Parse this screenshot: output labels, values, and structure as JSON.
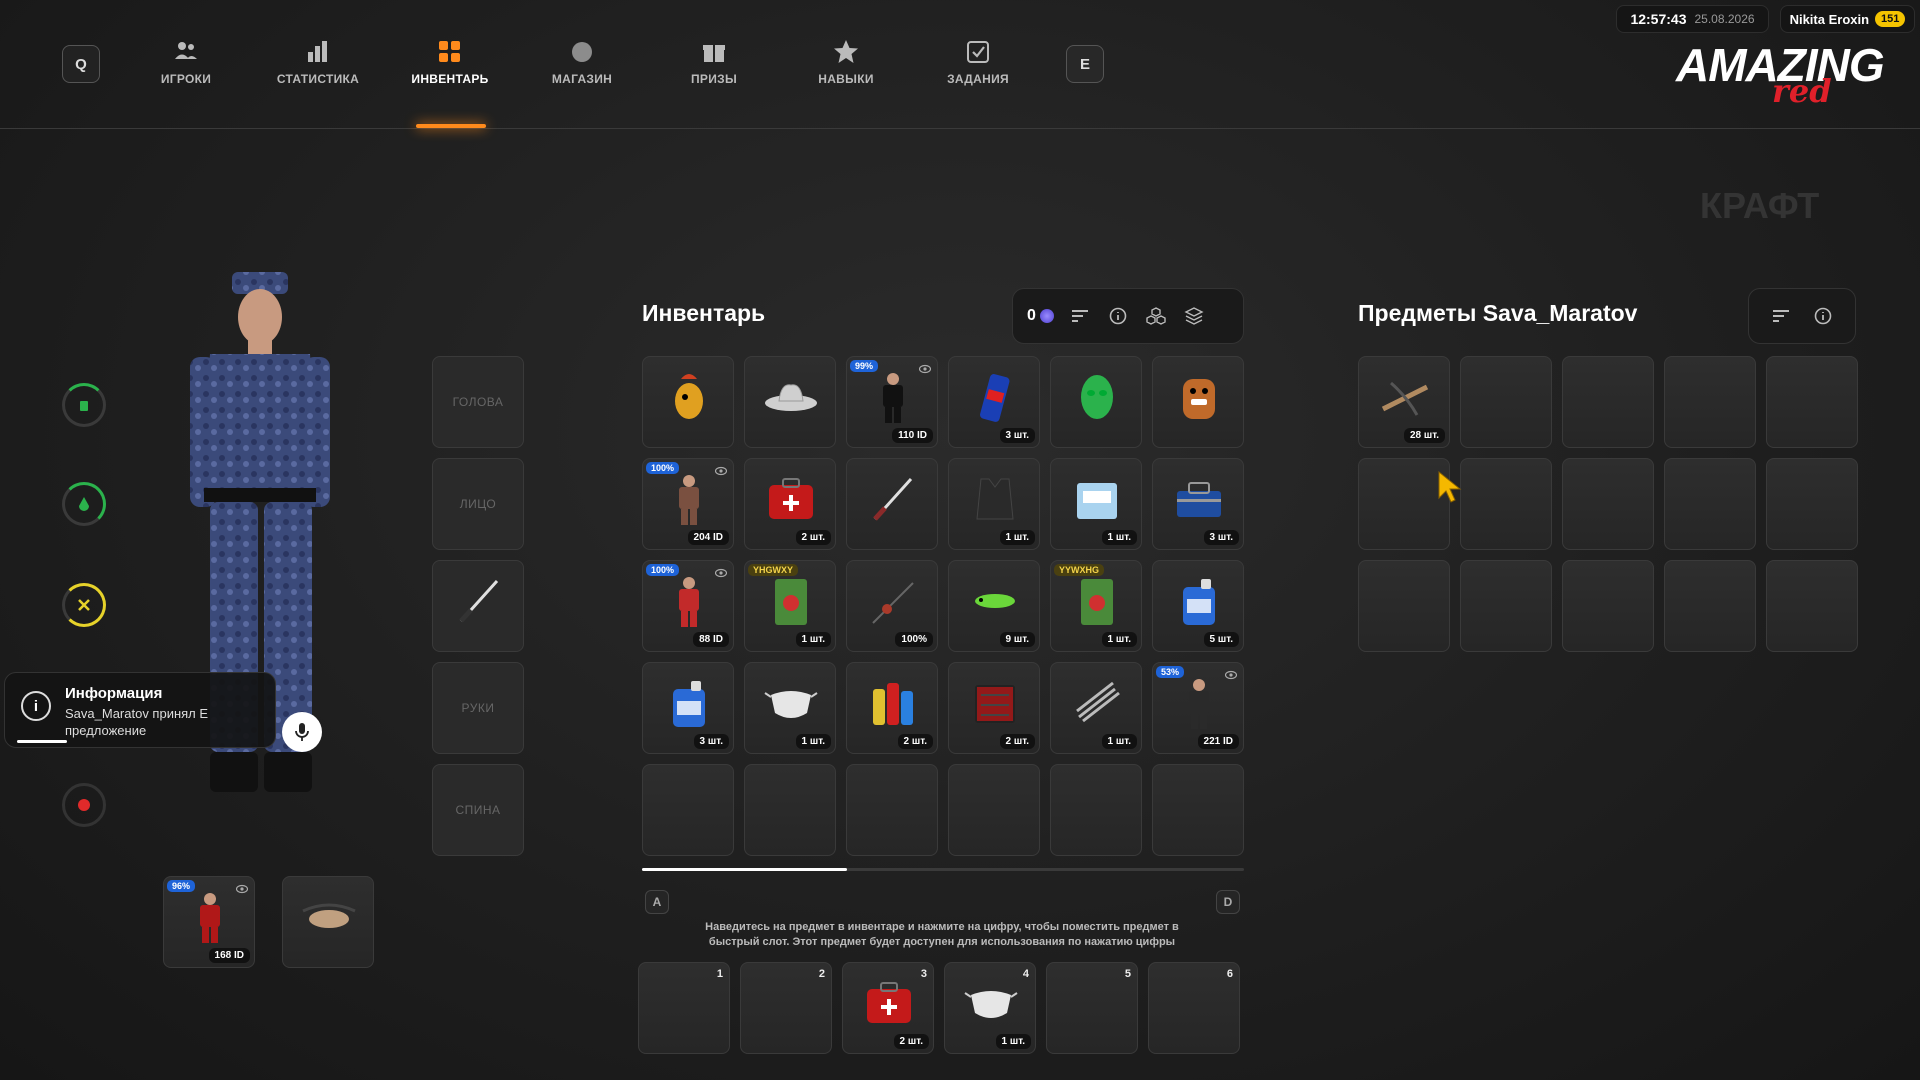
{
  "nav": {
    "left_key": "Q",
    "right_key": "E",
    "tabs": [
      {
        "label": "ИГРОКИ",
        "icon": "players-icon"
      },
      {
        "label": "СТАТИСТИКА",
        "icon": "stats-icon"
      },
      {
        "label": "ИНВЕНТАРЬ",
        "icon": "grid-icon",
        "active": true
      },
      {
        "label": "МАГАЗИН",
        "icon": "shop-icon"
      },
      {
        "label": "ПРИЗЫ",
        "icon": "gift-icon"
      },
      {
        "label": "НАВЫКИ",
        "icon": "star-icon"
      },
      {
        "label": "ЗАДАНИЯ",
        "icon": "tasks-icon"
      }
    ]
  },
  "status": {
    "time": "12:57:43",
    "date": "25.08.2026",
    "username": "Nikita Eroxin",
    "level": "151"
  },
  "logo": {
    "main": "AMAZING",
    "sub": "red"
  },
  "background": {
    "craft": "КРАФТ"
  },
  "body_slots": [
    "ГОЛОВА",
    "ЛИЦО",
    "",
    "РУКИ",
    "СПИНА"
  ],
  "toast": {
    "title": "Информация",
    "text": "Sava_Maratov принял Е предложение"
  },
  "inventory": {
    "title": "Инвентарь",
    "currency": "0",
    "items": [
      {
        "icon": "rooster-mask-icon",
        "color": "#d04020"
      },
      {
        "icon": "cowboy-hat-icon",
        "color": "#cfcfcf"
      },
      {
        "icon": "skin-icon",
        "color": "#111",
        "pct": "99%",
        "count": "110 ID",
        "eye": true
      },
      {
        "icon": "energy-drink-icon",
        "color": "#1a3fb5",
        "count": "3 шт."
      },
      {
        "icon": "hockey-mask-icon",
        "color": "#2bb24c"
      },
      {
        "icon": "backpack-icon",
        "color": "#c06a2a"
      },
      {
        "icon": "skin-icon",
        "color": "#7a5040",
        "pct": "100%",
        "count": "204 ID",
        "eye": true
      },
      {
        "icon": "medkit-icon",
        "color": "#c41a1a",
        "count": "2 шт."
      },
      {
        "icon": "katana-icon",
        "color": "#8a2a2a"
      },
      {
        "icon": "vest-icon",
        "color": "#2a2a2a",
        "count": "1 шт."
      },
      {
        "icon": "box-icon",
        "color": "#a9d3ef",
        "count": "1 шт."
      },
      {
        "icon": "toolbox-icon",
        "color": "#1f4da0",
        "count": "3 шт."
      },
      {
        "icon": "skin-icon",
        "color": "#c22a2a",
        "pct": "100%",
        "count": "88 ID",
        "eye": true
      },
      {
        "icon": "seed-pack-icon",
        "color": "#4a8a3a",
        "tag": "YHGWXY",
        "count": "1 шт."
      },
      {
        "icon": "fishing-rod-icon",
        "color": "#aa3a2a",
        "count": "100%"
      },
      {
        "icon": "lure-icon",
        "color": "#6ad63a",
        "count": "9 шт."
      },
      {
        "icon": "seed-pack-icon",
        "color": "#4a8a3a",
        "tag": "YYWXHG",
        "count": "1 шт."
      },
      {
        "icon": "canister-icon",
        "color": "#2a6ad6",
        "count": "5 шт."
      },
      {
        "icon": "canister-icon",
        "color": "#2a6ad6",
        "count": "3 шт."
      },
      {
        "icon": "face-mask-icon",
        "color": "#e6e6e6",
        "count": "1 шт."
      },
      {
        "icon": "cleaning-set-icon",
        "color": "#e0c030",
        "count": "2 шт."
      },
      {
        "icon": "tool-case-icon",
        "color": "#b01818",
        "count": "2 шт."
      },
      {
        "icon": "spring-icon",
        "color": "#bbbbbb",
        "count": "1 шт."
      },
      {
        "icon": "skin-icon",
        "color": "#2a2a2a",
        "pct": "53%",
        "count": "221 ID",
        "eye": true
      },
      {},
      {},
      {},
      {},
      {},
      {}
    ]
  },
  "other": {
    "title": "Предметы Sava_Maratov",
    "items": [
      {
        "icon": "crossbow-icon",
        "color": "#b08a60",
        "count": "28 шт."
      },
      {},
      {},
      {},
      {},
      {},
      {},
      {},
      {},
      {},
      {},
      {},
      {},
      {},
      {}
    ]
  },
  "equipped": [
    {
      "icon": "skin-icon",
      "color": "#b01818",
      "pct": "96%",
      "count": "168 ID",
      "eye": true
    },
    {
      "icon": "belt-bag-icon",
      "color": "#c0a080"
    }
  ],
  "pager": {
    "prev_key": "A",
    "next_key": "D",
    "progress": 0.34
  },
  "hint": "Наведитесь на предмет в инвентаре и нажмите на цифру, чтобы поместить предмет в быстрый слот. Этот предмет будет доступен для использования по нажатию цифры",
  "quickbar": [
    {
      "num": "1"
    },
    {
      "num": "2"
    },
    {
      "num": "3",
      "icon": "medkit-icon",
      "color": "#c41a1a",
      "count": "2 шт."
    },
    {
      "num": "4",
      "icon": "face-mask-icon",
      "color": "#e6e6e6",
      "count": "1 шт."
    },
    {
      "num": "5"
    },
    {
      "num": "6"
    }
  ]
}
